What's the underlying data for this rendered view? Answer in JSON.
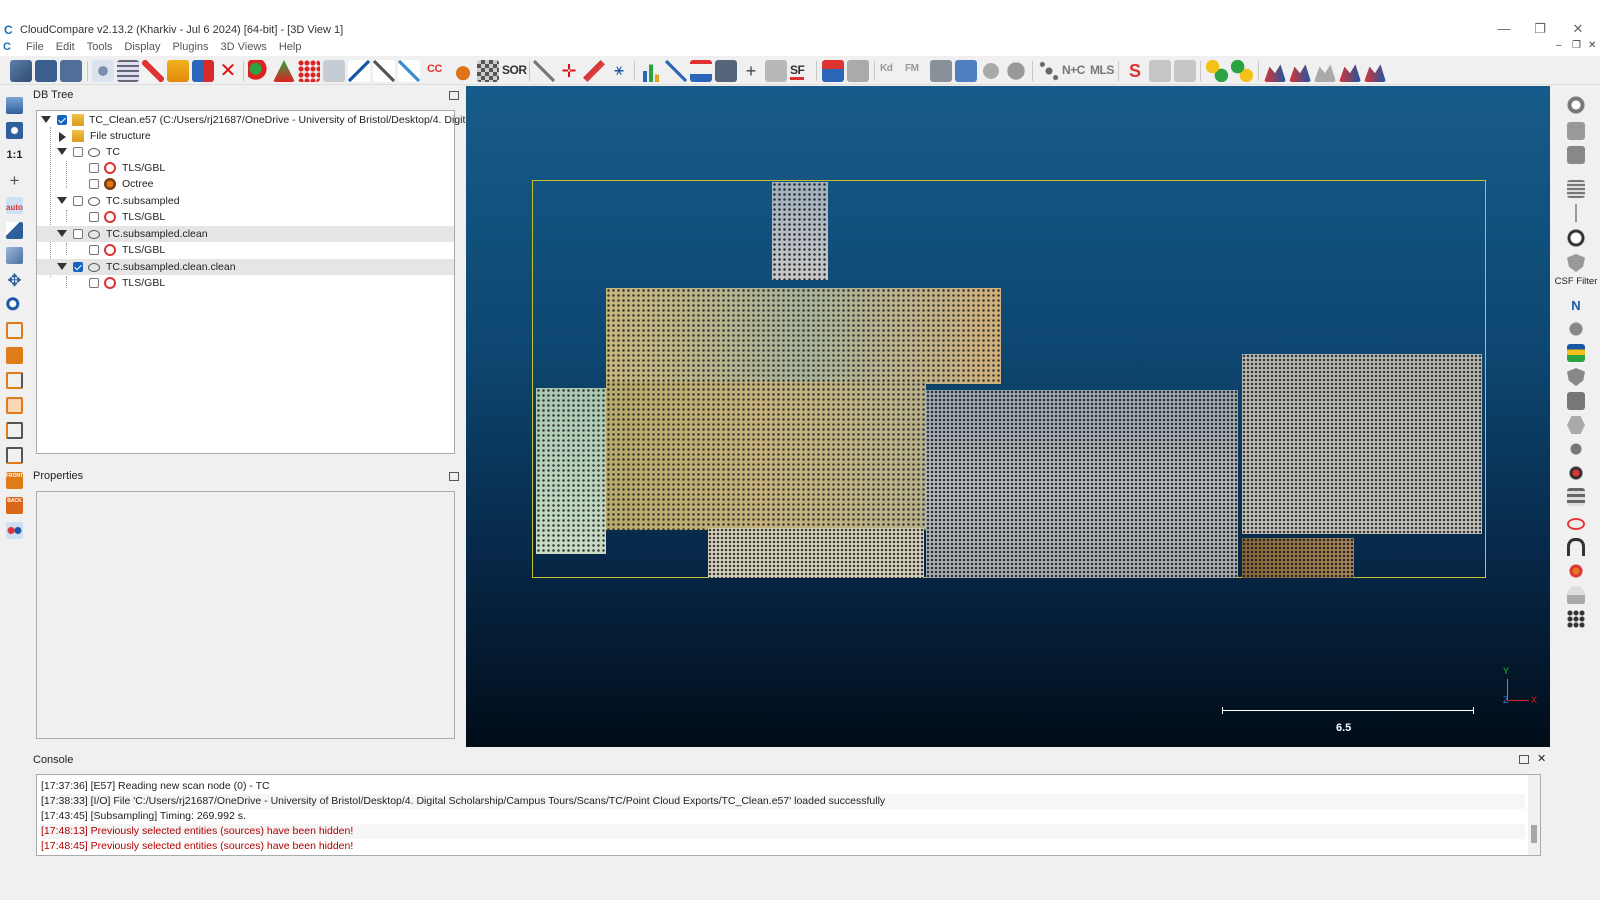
{
  "window": {
    "title": "CloudCompare v2.13.2 (Kharkiv - Jul  6 2024) [64-bit] - [3D View 1]",
    "controls": {
      "minimize": "—",
      "restore": "❐",
      "close": "✕"
    }
  },
  "menubar": {
    "items": [
      "File",
      "Edit",
      "Tools",
      "Display",
      "Plugins",
      "3D Views",
      "Help"
    ],
    "mdi": {
      "minimize": "–",
      "restore": "❐",
      "close": "✕"
    }
  },
  "toolbar": {
    "sor_label": "SOR",
    "sf_label": "SF",
    "kd_label": "Kd",
    "fm_label": "FM",
    "nc_label": "N+C",
    "mls_label": "MLS",
    "cc_label": "CC"
  },
  "leftbar": {
    "zoom_label": "1:1",
    "auto_label": "auto",
    "front_label": "FRONT",
    "back_label": "BACK"
  },
  "dbtree": {
    "title": "DB Tree",
    "rows": [
      {
        "label": "TC_Clean.e57 (C:/Users/rj21687/OneDrive - University of Bristol/Desktop/4. Digit...",
        "checked": true
      },
      {
        "label": "File structure"
      },
      {
        "label": "TC",
        "checked": false
      },
      {
        "label": "TLS/GBL",
        "checked": false
      },
      {
        "label": "Octree",
        "checked": false
      },
      {
        "label": "TC.subsampled",
        "checked": false
      },
      {
        "label": "TLS/GBL",
        "checked": false
      },
      {
        "label": "TC.subsampled.clean",
        "checked": false
      },
      {
        "label": "TLS/GBL",
        "checked": false
      },
      {
        "label": "TC.subsampled.clean.clean",
        "checked": true
      },
      {
        "label": "TLS/GBL",
        "checked": false
      }
    ]
  },
  "properties": {
    "title": "Properties"
  },
  "view3d": {
    "scale_value": "6.5",
    "axes": {
      "x": "X",
      "y": "Y",
      "z": "Z"
    },
    "colors": {
      "bbox": "#c7c12a",
      "bg_top": "#175b8a",
      "bg_bottom": "#010c18"
    }
  },
  "rightbar": {
    "csf_label": "CSF Filter",
    "n_label": "N"
  },
  "console": {
    "title": "Console",
    "lines": [
      {
        "text": "[17:37:36] [E57] Reading new scan node (0) - TC",
        "error": false
      },
      {
        "text": "[17:38:33] [I/O] File 'C:/Users/rj21687/OneDrive - University of Bristol/Desktop/4. Digital Scholarship/Campus Tours/Scans/TC/Point Cloud Exports/TC_Clean.e57' loaded successfully",
        "error": false
      },
      {
        "text": "[17:43:45] [Subsampling] Timing: 269.992 s.",
        "error": false
      },
      {
        "text": "[17:48:13] Previously selected entities (sources) have been hidden!",
        "error": true
      },
      {
        "text": "[17:48:45] Previously selected entities (sources) have been hidden!",
        "error": true
      }
    ]
  }
}
